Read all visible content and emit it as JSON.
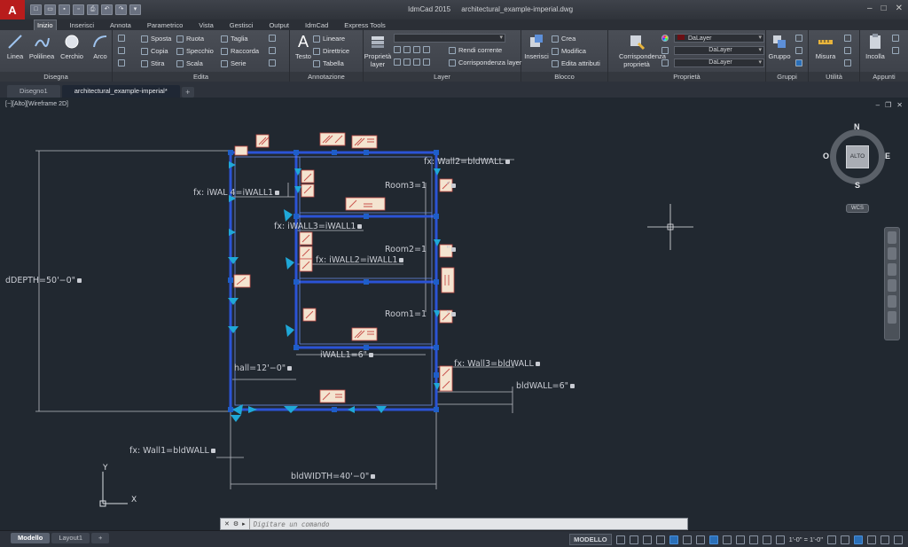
{
  "titlebar": {
    "app_name": "IdmCad 2015",
    "file_name": "architectural_example-imperial.dwg",
    "logo": "A"
  },
  "quick_access": [
    "new-icon",
    "open-icon",
    "save-icon",
    "save-as-icon",
    "print-icon",
    "undo-icon",
    "redo-icon",
    "customize-icon"
  ],
  "ribbon_tabs": [
    "Inizio",
    "Inserisci",
    "Annota",
    "Parametrico",
    "Vista",
    "Gestisci",
    "Output",
    "IdmCad",
    "Express Tools"
  ],
  "ribbon": {
    "disegna": {
      "title": "Disegna",
      "tools": [
        "Linea",
        "Polilinea",
        "Cerchio",
        "Arco"
      ]
    },
    "edita": {
      "title": "Edita",
      "tools": [
        "Sposta",
        "Ruota",
        "Taglia",
        "Copia",
        "Specchio",
        "Raccorda",
        "Stira",
        "Scala",
        "Serie"
      ]
    },
    "annotazione": {
      "title": "Annotazione",
      "tools": [
        "Testo",
        "Lineare",
        "Direttrice",
        "Tabella"
      ]
    },
    "layer": {
      "title": "Layer",
      "big": "Proprietà layer",
      "tools": [
        "Rendi corrente",
        "Corrispondenza layer"
      ]
    },
    "blocco": {
      "title": "Blocco",
      "big": "Inserisci",
      "tools": [
        "Crea",
        "Modifica",
        "Edita attributi"
      ]
    },
    "proprieta": {
      "title": "Proprietà",
      "big": "Corrispondenza proprietà",
      "color_value": "DaLayer",
      "linetype_value": "DaLayer",
      "lineweight_value": "DaLayer"
    },
    "gruppi": {
      "title": "Gruppi",
      "big": "Gruppo"
    },
    "utilita": {
      "title": "Utilità",
      "big": "Misura"
    },
    "appunti": {
      "title": "Appunti",
      "big": "Incolla"
    }
  },
  "doc_tabs": [
    "Disegno1",
    "architectural_example-imperial*"
  ],
  "viewport": {
    "label": "[−][Alto][Wireframe 2D]"
  },
  "drawing": {
    "dims": {
      "fx_wall2": "fx: Wall2=bldWALL",
      "room3": "Room3=1",
      "fx_iwall4": "fx: iWAL 4=iWALL1",
      "fx_iwall3": "fx: iWALL3=iWALL1",
      "room2": "Room2=1",
      "fx_iwall2": "fx: iWALL2=iWALL1",
      "ddepth": "dDEPTH=50'−0\"",
      "room1": "Room1=1",
      "iwall1": "iWALL1=6\"",
      "hall": "hall=12'−0\"",
      "fx_wall3": "fx: Wall3=bldWALL",
      "bldwall": "bldWALL=6\"",
      "fx_wall1": "fx: Wall1=bldWALL",
      "bldwidth": "bldWIDTH=40'−0\""
    }
  },
  "viewcube": {
    "face": "ALTO",
    "north": "N",
    "south": "S",
    "east": "E",
    "west": "O",
    "wcs": "WCS"
  },
  "ucs": {
    "x": "X",
    "y": "Y"
  },
  "command_line": {
    "placeholder": "Digitare un comando"
  },
  "layout_tabs": [
    "Modello",
    "Layout1"
  ],
  "status": {
    "space": "MODELLO",
    "scale": "1'-0\" = 1'-0\""
  },
  "colors": {
    "wall": "#2b53d6",
    "grip": "#1e5ec8",
    "constraint": "#1fa8d8",
    "dim_text": "#c9ccd3",
    "canvas_bg": "#212830",
    "badge_bg": "#f4e4d0",
    "badge_border": "#c9504a"
  }
}
